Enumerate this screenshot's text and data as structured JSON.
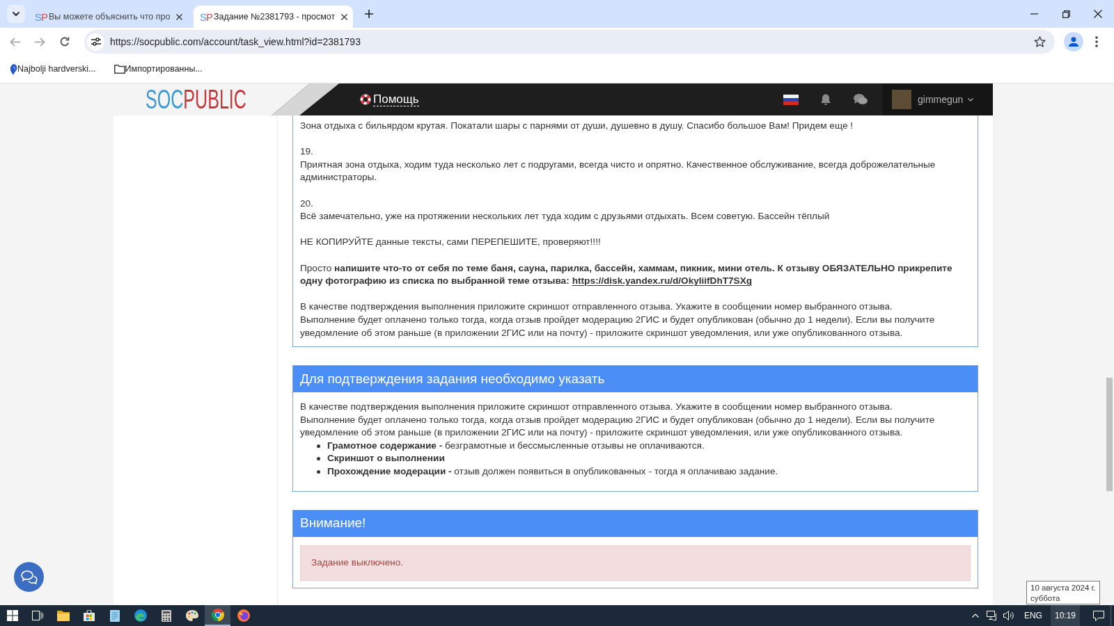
{
  "browser": {
    "tabs": [
      {
        "favicon": "SP",
        "title": "Вы можете объяснить что про",
        "selected": false
      },
      {
        "favicon": "SP",
        "title": "Задание №2381793 - просмот",
        "selected": true
      }
    ],
    "url": "https://socpublic.com/account/task_view.html?id=2381793",
    "bookmarks": [
      {
        "kind": "site",
        "label": "Najbolji hardverski..."
      },
      {
        "kind": "folder",
        "label": "Импортированны..."
      }
    ]
  },
  "site_header": {
    "logo": [
      "SOC",
      "PUBLIC"
    ],
    "help_link": "Помощь",
    "username": "gimmegun"
  },
  "task_description": {
    "paragraphs": [
      {
        "kind": "review",
        "text": "Зона отдыха с бильярдом крутая. Покатали шары с парнями от души, душевно в душу. Спасибо большое Вам! Придем еще !"
      },
      {
        "kind": "review",
        "number": "19.",
        "text": "Приятная зона отдыха, ходим туда несколько лет с подругами, всегда чисто и опрятно. Качественное обслуживание, всегда доброжелательные администраторы."
      },
      {
        "kind": "review",
        "number": "20.",
        "text": "Всё замечательно, уже на протяжении нескольких лет туда ходим с друзьями отдыхать. Всем советую. Бассейн тёплый"
      },
      {
        "kind": "note",
        "lines": [
          "НЕ КОПИРУЙТЕ данные тексты, сами ПЕРЕПЕШИТЕ, проверяют!!!!"
        ]
      },
      {
        "kind": "note",
        "lines": [
          "Просто **напишите что-то от себя по теме баня, сауна, парилка, бассейн, хаммам, пикник, мини отель. К отзыву ОБЯЗАТЕЛЬНО прикрепите одну фотографию из списка по выбранной теме отзыва:**"
        ],
        "link": "https://disk.yandex.ru/d/OkyliifDhT7SXg"
      },
      {
        "kind": "note",
        "lines": [
          "В качестве подтверждения выполнения приложите скриншот отправленного отзыва. Укажите в сообщении номер выбранного отзыва.",
          "Выполнение будет оплачено только тогда, когда отзыв пройдет модерацию 2ГИС и будет опубликован (обычно до 1 недели). Если вы получите уведомление об этом раньше (в приложении 2ГИС или на почту) - приложите скриншот уведомления, или уже опубликованного отзыва."
        ]
      }
    ]
  },
  "confirmation_panel": {
    "title": "Для подтверждения задания необходимо указать",
    "lines": [
      "В качестве подтверждения выполнения приложите скриншот отправленного отзыва. Укажите в сообщении номер выбранного отзыва.",
      "Выполнение будет оплачено только тогда, когда отзыв пройдет модерацию 2ГИС и будет опубликован (обычно до 1 недели). Если вы получите уведомление об этом раньше (в приложении 2ГИС или на почту) - приложите скриншот уведомления, или уже опубликованного отзыва."
    ],
    "requirements": [
      {
        "term": "Грамотное содержание -",
        "description": "безграмотные и бессмысленные отзывы не оплачиваются."
      },
      {
        "term": "Скриншот о выполнении"
      },
      {
        "term": "Прохождение модерации -",
        "description": "отзыв должен появиться в опубликованных - тогда я оплачиваю задание."
      }
    ]
  },
  "warning_panel": {
    "title": "Внимание!",
    "alert": "Задание выключено."
  },
  "taskbar": {
    "apps": [
      {
        "kind": "start",
        "selected": false
      },
      {
        "kind": "taskview",
        "selected": false
      },
      {
        "kind": "folder",
        "selected": false
      },
      {
        "kind": "bag",
        "selected": false
      },
      {
        "kind": "notepad",
        "selected": false
      },
      {
        "kind": "wave",
        "selected": false
      },
      {
        "kind": "calculator",
        "selected": false
      },
      {
        "kind": "palette",
        "selected": false
      },
      {
        "kind": "ring",
        "selected": true
      },
      {
        "kind": "fox",
        "selected": false
      }
    ],
    "language": "ENG",
    "time": "10:19"
  },
  "clock_tooltip": {
    "date": "10 августа 2024 г.",
    "weekday": "суббота"
  }
}
